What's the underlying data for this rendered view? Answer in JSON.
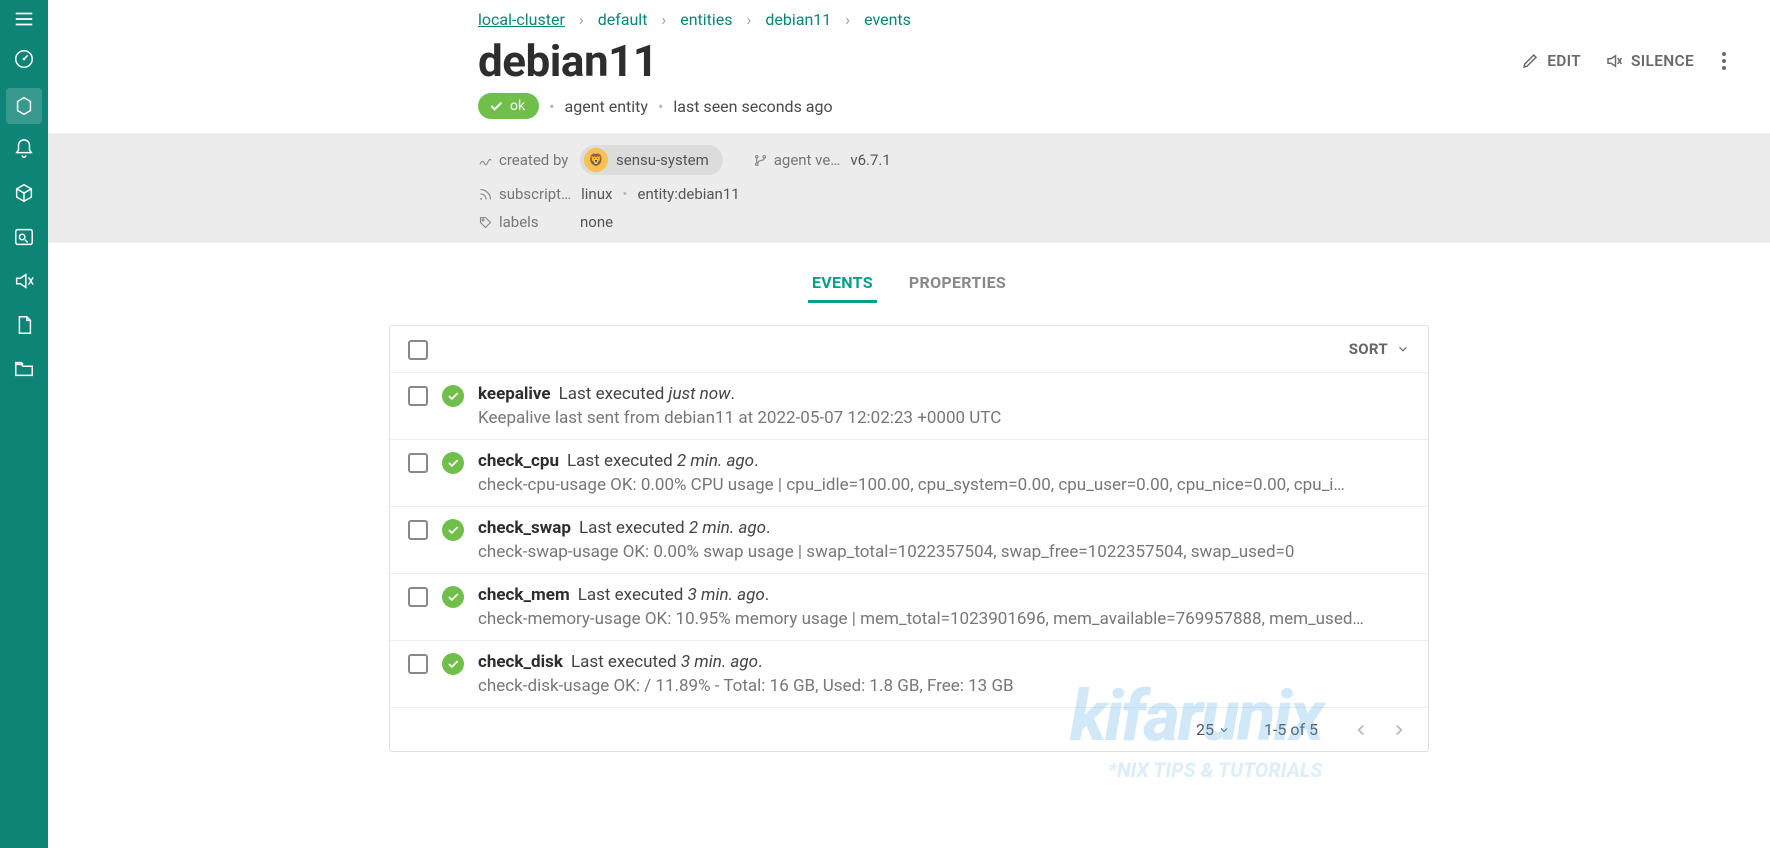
{
  "breadcrumb": [
    "local-cluster",
    "default",
    "entities",
    "debian11",
    "events"
  ],
  "page_title": "debian11",
  "actions": {
    "edit": "EDIT",
    "silence": "SILENCE"
  },
  "status_chip": "ok",
  "subline": {
    "entity_type": "agent entity",
    "last_seen": "last seen seconds ago"
  },
  "meta": {
    "created_by_label": "created by",
    "created_by_user": "sensu-system",
    "agent_version_label": "agent ve…",
    "agent_version": "v6.7.1",
    "subscriptions_label": "subscript…",
    "subscriptions": [
      "linux",
      "entity:debian11"
    ],
    "labels_label": "labels",
    "labels_value": "none"
  },
  "tabs": {
    "events": "EVENTS",
    "properties": "PROPERTIES"
  },
  "sort_label": "SORT",
  "events": [
    {
      "name": "keepalive",
      "exec_prefix": "Last executed",
      "exec_rel": "just now",
      "output": "Keepalive last sent from debian11 at 2022-05-07 12:02:23 +0000 UTC"
    },
    {
      "name": "check_cpu",
      "exec_prefix": "Last executed",
      "exec_rel": "2 min. ago",
      "output": "check-cpu-usage OK: 0.00% CPU usage | cpu_idle=100.00, cpu_system=0.00, cpu_user=0.00, cpu_nice=0.00, cpu_i…"
    },
    {
      "name": "check_swap",
      "exec_prefix": "Last executed",
      "exec_rel": "2 min. ago",
      "output": "check-swap-usage OK: 0.00% swap usage | swap_total=1022357504, swap_free=1022357504, swap_used=0"
    },
    {
      "name": "check_mem",
      "exec_prefix": "Last executed",
      "exec_rel": "3 min. ago",
      "output": "check-memory-usage OK: 10.95% memory usage | mem_total=1023901696, mem_available=769957888, mem_used…"
    },
    {
      "name": "check_disk",
      "exec_prefix": "Last executed",
      "exec_rel": "3 min. ago",
      "output": "check-disk-usage OK: / 11.89% - Total: 16 GB, Used: 1.8 GB, Free: 13 GB"
    }
  ],
  "pagination": {
    "page_size": "25",
    "range": "1-5 of 5"
  },
  "watermark": {
    "big": "kifarunix",
    "sm": "*NIX TIPS & TUTORIALS"
  }
}
